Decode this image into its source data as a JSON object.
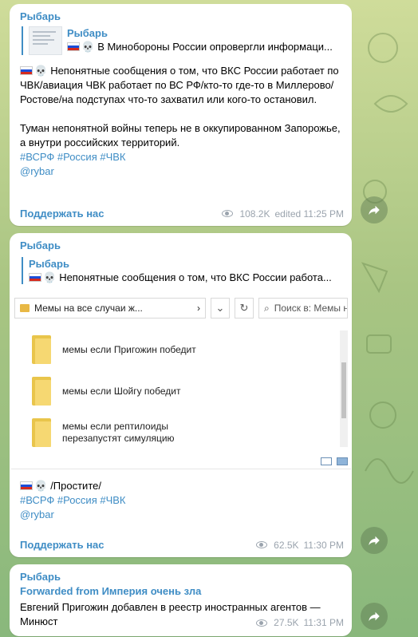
{
  "messages": [
    {
      "sender": "Рыбарь",
      "reply": {
        "name": "Рыбарь",
        "text": "В Минобороны России опровергли информаци..."
      },
      "body": [
        "Непонятные сообщения о том, что ВКС России работает по ЧВК/авиация ЧВК работает по ВС РФ/кто-то где-то в Миллерово/Ростове/на подступах что-то захватил или кого-то остановил.",
        "Туман непонятной войны теперь не в оккупированном Запорожье, а внутри российских территорий."
      ],
      "tags": "#ВСРФ #Россия #ЧВК",
      "link": "@rybar",
      "support": "Поддержать нас",
      "views": "108.2K",
      "time": "edited 11:25 PM"
    },
    {
      "sender": "Рыбарь",
      "reply": {
        "name": "Рыбарь",
        "text": "Непонятные сообщения о том, что ВКС России работа..."
      },
      "explorer": {
        "path": "Мемы на все случаи ж...",
        "search_placeholder": "Поиск в: Мемы н...",
        "items": [
          "мемы если Пригожин победит",
          "мемы если Шойгу победит",
          "мемы если рептилоиды перезапустят симуляцию"
        ]
      },
      "body": [
        "/Простите/"
      ],
      "tags": "#ВСРФ #Россия #ЧВК",
      "link": "@rybar",
      "support": "Поддержать нас",
      "views": "62.5K",
      "time": "11:30 PM"
    },
    {
      "sender": "Рыбарь",
      "forwarded": "Forwarded from Империя очень зла",
      "body": [
        "Евгений Пригожин добавлен в реестр иностранных агентов — Минюст"
      ],
      "views": "27.5K",
      "time": "11:31 PM"
    }
  ],
  "icons": {
    "share": "share-arrow-icon",
    "views": "eye-icon",
    "skull": "skull-icon",
    "flag": "russia-flag-icon"
  },
  "colors": {
    "accent": "#3f8dc5",
    "meta": "#9aa3ad"
  }
}
